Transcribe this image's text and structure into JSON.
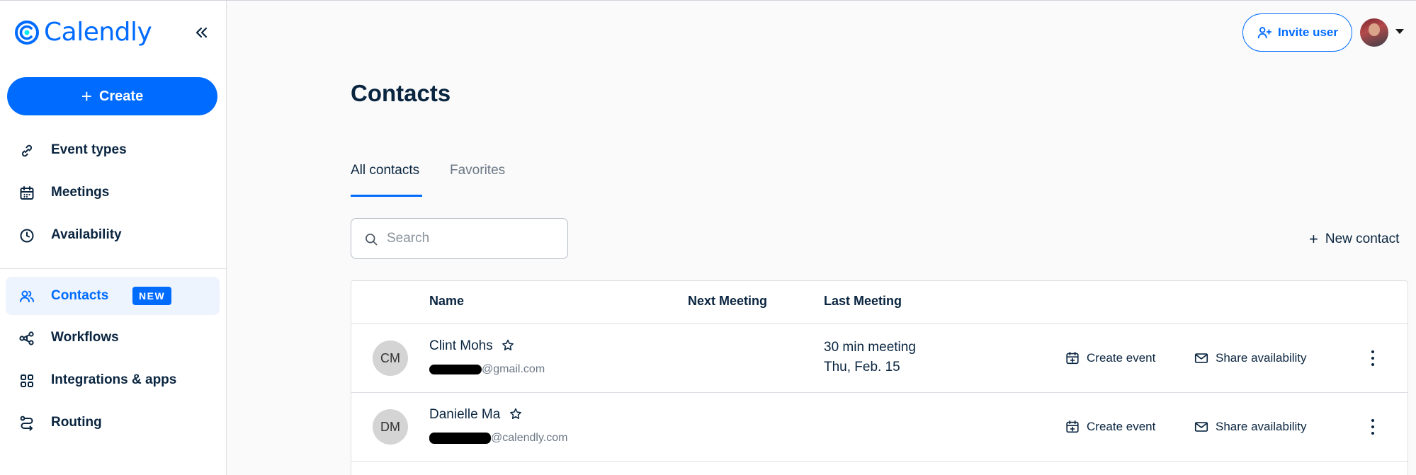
{
  "app": {
    "logo_text": "Calendly"
  },
  "sidebar": {
    "create_label": "Create",
    "items": [
      {
        "label": "Event types",
        "icon": "link-icon"
      },
      {
        "label": "Meetings",
        "icon": "calendar-icon"
      },
      {
        "label": "Availability",
        "icon": "clock-icon"
      },
      {
        "label": "Contacts",
        "icon": "contacts-icon",
        "badge": "NEW",
        "active": true
      },
      {
        "label": "Workflows",
        "icon": "workflows-icon"
      },
      {
        "label": "Integrations & apps",
        "icon": "grid-apps-icon"
      },
      {
        "label": "Routing",
        "icon": "routing-icon"
      }
    ]
  },
  "header": {
    "invite_label": "Invite user"
  },
  "page": {
    "title": "Contacts",
    "tabs": [
      {
        "label": "All contacts",
        "active": true
      },
      {
        "label": "Favorites",
        "active": false
      }
    ],
    "search": {
      "placeholder": "Search",
      "value": ""
    },
    "new_contact_label": "New contact"
  },
  "table": {
    "columns": [
      "Name",
      "Next Meeting",
      "Last Meeting"
    ],
    "rows": [
      {
        "initials": "CM",
        "name": "Clint Mohs",
        "email_visible": "@gmail.com",
        "next_meeting": "",
        "last_meeting_title": "30 min meeting",
        "last_meeting_date": "Thu, Feb. 15",
        "create_event": "Create event",
        "share_availability": "Share availability"
      },
      {
        "initials": "DM",
        "name": "Danielle Ma",
        "email_visible": "@calendly.com",
        "next_meeting": "",
        "last_meeting_title": "",
        "last_meeting_date": "",
        "create_event": "Create event",
        "share_availability": "Share availability"
      }
    ]
  },
  "colors": {
    "accent": "#006bff",
    "text": "#0a2540",
    "muted": "#6b7785",
    "active_bg": "#eef4fd"
  }
}
